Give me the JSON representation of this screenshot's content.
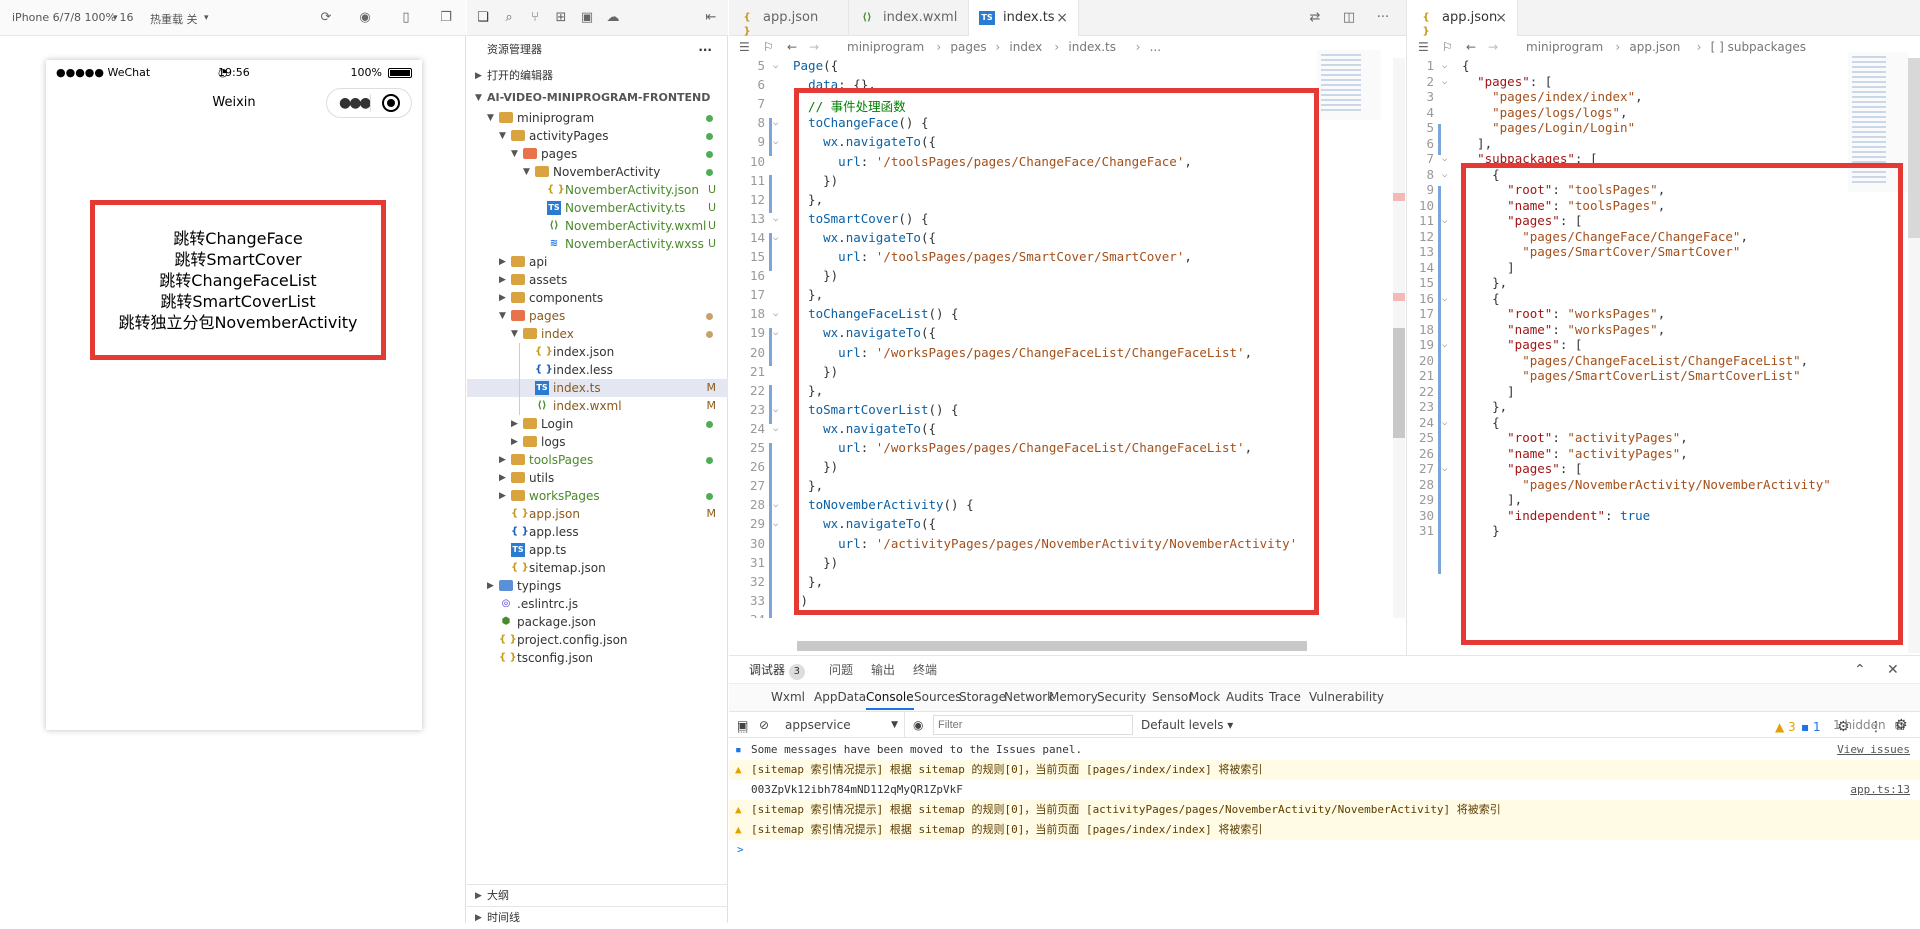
{
  "simulator": {
    "device": "iPhone 6/7/8 100% 16",
    "hot_reload": "热重载 关",
    "status": {
      "carrier": "●●●●● WeChat",
      "time": "19:56",
      "battery": "100%"
    },
    "nav_title": "Weixin",
    "buttons": [
      "跳转ChangeFace",
      "跳转SmartCover",
      "跳转ChangeFaceList",
      "跳转SmartCoverList",
      "跳转独立分包NovemberActivity"
    ]
  },
  "explorer": {
    "title": "资源管理器",
    "more": "···",
    "open_editors": "打开的编辑器",
    "project": "AI-VIDEO-MINIPROGRAM-FRONTEND",
    "tree": [
      {
        "name": "miniprogram",
        "depth": 1,
        "type": "folder",
        "open": true,
        "dot": "#4caf50"
      },
      {
        "name": "activityPages",
        "depth": 2,
        "type": "folder",
        "open": true,
        "dot": "#4caf50"
      },
      {
        "name": "pages",
        "depth": 3,
        "type": "folder-red",
        "open": true,
        "dot": "#4caf50"
      },
      {
        "name": "NovemberActivity",
        "depth": 4,
        "type": "folder",
        "open": true,
        "dot": "#4caf50"
      },
      {
        "name": "NovemberActivity.json",
        "depth": 5,
        "type": "json",
        "badge": "U",
        "color": "#4a8a2a"
      },
      {
        "name": "NovemberActivity.ts",
        "depth": 5,
        "type": "ts",
        "badge": "U",
        "color": "#4a8a2a"
      },
      {
        "name": "NovemberActivity.wxml",
        "depth": 5,
        "type": "wxml",
        "badge": "U",
        "color": "#4a8a2a"
      },
      {
        "name": "NovemberActivity.wxss",
        "depth": 5,
        "type": "wxss",
        "badge": "U",
        "color": "#4a8a2a"
      },
      {
        "name": "api",
        "depth": 2,
        "type": "folder",
        "open": false
      },
      {
        "name": "assets",
        "depth": 2,
        "type": "folder",
        "open": false
      },
      {
        "name": "components",
        "depth": 2,
        "type": "folder",
        "open": false
      },
      {
        "name": "pages",
        "depth": 2,
        "type": "folder-red",
        "open": true,
        "dot": "#c8a26a",
        "color": "#8a5a1a"
      },
      {
        "name": "index",
        "depth": 3,
        "type": "folder",
        "open": true,
        "dot": "#c8a26a",
        "color": "#8a5a1a"
      },
      {
        "name": "index.json",
        "depth": 4,
        "type": "json",
        "guide": true
      },
      {
        "name": "index.less",
        "depth": 4,
        "type": "less",
        "guide": true
      },
      {
        "name": "index.ts",
        "depth": 4,
        "type": "ts",
        "badge": "M",
        "color": "#8a5a1a",
        "selected": true,
        "guide": true
      },
      {
        "name": "index.wxml",
        "depth": 4,
        "type": "wxml",
        "badge": "M",
        "color": "#8a5a1a",
        "guide": true
      },
      {
        "name": "Login",
        "depth": 3,
        "type": "folder",
        "open": false,
        "dot": "#4caf50"
      },
      {
        "name": "logs",
        "depth": 3,
        "type": "folder",
        "open": false
      },
      {
        "name": "toolsPages",
        "depth": 2,
        "type": "folder",
        "open": false,
        "dot": "#4caf50",
        "color": "#4a8a2a"
      },
      {
        "name": "utils",
        "depth": 2,
        "type": "folder",
        "open": false
      },
      {
        "name": "worksPages",
        "depth": 2,
        "type": "folder",
        "open": false,
        "dot": "#4caf50",
        "color": "#4a8a2a"
      },
      {
        "name": "app.json",
        "depth": 2,
        "type": "json",
        "badge": "M",
        "color": "#8a5a1a"
      },
      {
        "name": "app.less",
        "depth": 2,
        "type": "less"
      },
      {
        "name": "app.ts",
        "depth": 2,
        "type": "ts"
      },
      {
        "name": "sitemap.json",
        "depth": 2,
        "type": "json"
      },
      {
        "name": "typings",
        "depth": 1,
        "type": "folder-blue",
        "open": false
      },
      {
        "name": ".eslintrc.js",
        "depth": 1,
        "type": "eslint"
      },
      {
        "name": "package.json",
        "depth": 1,
        "type": "pkg"
      },
      {
        "name": "project.config.json",
        "depth": 1,
        "type": "json"
      },
      {
        "name": "tsconfig.json",
        "depth": 1,
        "type": "json"
      }
    ],
    "outline": "大纲",
    "timeline": "时间线"
  },
  "editor1": {
    "tabs": [
      {
        "label": "app.json",
        "icon": "json"
      },
      {
        "label": "index.wxml",
        "icon": "wxml"
      },
      {
        "label": "index.ts",
        "icon": "ts",
        "active": true,
        "close": "×"
      }
    ],
    "breadcrumb": [
      "miniprogram",
      "pages",
      "index",
      "index.ts",
      "..."
    ],
    "lines": [
      {
        "n": "5",
        "t": "Page({"
      },
      {
        "n": "6",
        "t": "  data: {},"
      },
      {
        "n": "7",
        "t": "  // 事件处理函数"
      },
      {
        "n": "8",
        "t": "  toChangeFace() {"
      },
      {
        "n": "9",
        "t": "    wx.navigateTo({"
      },
      {
        "n": "10",
        "t": "      url: '/toolsPages/pages/ChangeFace/ChangeFace',"
      },
      {
        "n": "11",
        "t": "    })"
      },
      {
        "n": "12",
        "t": "  },"
      },
      {
        "n": "13",
        "t": "  toSmartCover() {"
      },
      {
        "n": "14",
        "t": "    wx.navigateTo({"
      },
      {
        "n": "15",
        "t": "      url: '/toolsPages/pages/SmartCover/SmartCover',"
      },
      {
        "n": "16",
        "t": "    })"
      },
      {
        "n": "17",
        "t": "  },"
      },
      {
        "n": "18",
        "t": "  toChangeFaceList() {"
      },
      {
        "n": "19",
        "t": "    wx.navigateTo({"
      },
      {
        "n": "20",
        "t": "      url: '/worksPages/pages/ChangeFaceList/ChangeFaceList',"
      },
      {
        "n": "21",
        "t": "    })"
      },
      {
        "n": "22",
        "t": "  },"
      },
      {
        "n": "23",
        "t": "  toSmartCoverList() {"
      },
      {
        "n": "24",
        "t": "    wx.navigateTo({"
      },
      {
        "n": "25",
        "t": "      url: '/worksPages/pages/ChangeFaceList/ChangeFaceList',"
      },
      {
        "n": "26",
        "t": "    })"
      },
      {
        "n": "27",
        "t": "  },"
      },
      {
        "n": "28",
        "t": "  toNovemberActivity() {"
      },
      {
        "n": "29",
        "t": "    wx.navigateTo({"
      },
      {
        "n": "30",
        "t": "      url: '/activityPages/pages/NovemberActivity/NovemberActivity'"
      },
      {
        "n": "31",
        "t": "    })"
      },
      {
        "n": "32",
        "t": "  },"
      },
      {
        "n": "33",
        "t": "})"
      },
      {
        "n": "34",
        "t": ""
      }
    ]
  },
  "editor2": {
    "tabs": [
      {
        "label": "app.json",
        "icon": "json",
        "active": true,
        "close": "×"
      }
    ],
    "breadcrumb": [
      "miniprogram",
      "app.json",
      "[ ] subpackages"
    ],
    "lines": [
      {
        "n": "1",
        "t": "{"
      },
      {
        "n": "2",
        "t": "  \"pages\": ["
      },
      {
        "n": "3",
        "t": "    \"pages/index/index\","
      },
      {
        "n": "4",
        "t": "    \"pages/logs/logs\","
      },
      {
        "n": "5",
        "t": "    \"pages/Login/Login\""
      },
      {
        "n": "6",
        "t": "  ],"
      },
      {
        "n": "7",
        "t": "  \"subpackages\": ["
      },
      {
        "n": "8",
        "t": "    {"
      },
      {
        "n": "9",
        "t": "      \"root\": \"toolsPages\","
      },
      {
        "n": "10",
        "t": "      \"name\": \"toolsPages\","
      },
      {
        "n": "11",
        "t": "      \"pages\": ["
      },
      {
        "n": "12",
        "t": "        \"pages/ChangeFace/ChangeFace\","
      },
      {
        "n": "13",
        "t": "        \"pages/SmartCover/SmartCover\""
      },
      {
        "n": "14",
        "t": "      ]"
      },
      {
        "n": "15",
        "t": "    },"
      },
      {
        "n": "16",
        "t": "    {"
      },
      {
        "n": "17",
        "t": "      \"root\": \"worksPages\","
      },
      {
        "n": "18",
        "t": "      \"name\": \"worksPages\","
      },
      {
        "n": "19",
        "t": "      \"pages\": ["
      },
      {
        "n": "20",
        "t": "        \"pages/ChangeFaceList/ChangeFaceList\","
      },
      {
        "n": "21",
        "t": "        \"pages/SmartCoverList/SmartCoverList\""
      },
      {
        "n": "22",
        "t": "      ]"
      },
      {
        "n": "23",
        "t": "    },"
      },
      {
        "n": "24",
        "t": "    {"
      },
      {
        "n": "25",
        "t": "      \"root\": \"activityPages\","
      },
      {
        "n": "26",
        "t": "      \"name\": \"activityPages\","
      },
      {
        "n": "27",
        "t": "      \"pages\": ["
      },
      {
        "n": "28",
        "t": "        \"pages/NovemberActivity/NovemberActivity\""
      },
      {
        "n": "29",
        "t": "      ],"
      },
      {
        "n": "30",
        "t": "      \"independent\": true"
      },
      {
        "n": "31",
        "t": "    }"
      }
    ]
  },
  "panel": {
    "tabs": [
      {
        "label": "调试器",
        "count": "3"
      },
      {
        "label": "问题"
      },
      {
        "label": "输出"
      },
      {
        "label": "终端"
      }
    ],
    "devtabs": [
      "Wxml",
      "AppData",
      "Console",
      "Sources",
      "Storage",
      "Network",
      "Memory",
      "Security",
      "Sensor",
      "Mock",
      "Audits",
      "Trace",
      "Vulnerability"
    ],
    "active_devtab": "Console",
    "warn_count": "3",
    "info_count": "1",
    "context": "appservice",
    "filter_placeholder": "Filter",
    "levels": "Default levels",
    "hidden": "1 hidden",
    "logs": [
      {
        "type": "info",
        "text": "Some messages have been moved to the Issues panel.",
        "src": "View issues"
      },
      {
        "type": "warn",
        "text": "[sitemap 索引情况提示] 根据 sitemap 的规则[0]，当前页面 [pages/index/index] 将被索引"
      },
      {
        "type": "plain",
        "text": "003ZpVk12ibh784mND112qMyQR1ZpVkF",
        "src": "app.ts:13"
      },
      {
        "type": "warn",
        "text": "[sitemap 索引情况提示] 根据 sitemap 的规则[0]，当前页面 [activityPages/pages/NovemberActivity/NovemberActivity] 将被索引"
      },
      {
        "type": "warn",
        "text": "[sitemap 索引情况提示] 根据 sitemap 的规则[0]，当前页面 [pages/index/index] 将被索引"
      }
    ],
    "prompt": ">"
  }
}
